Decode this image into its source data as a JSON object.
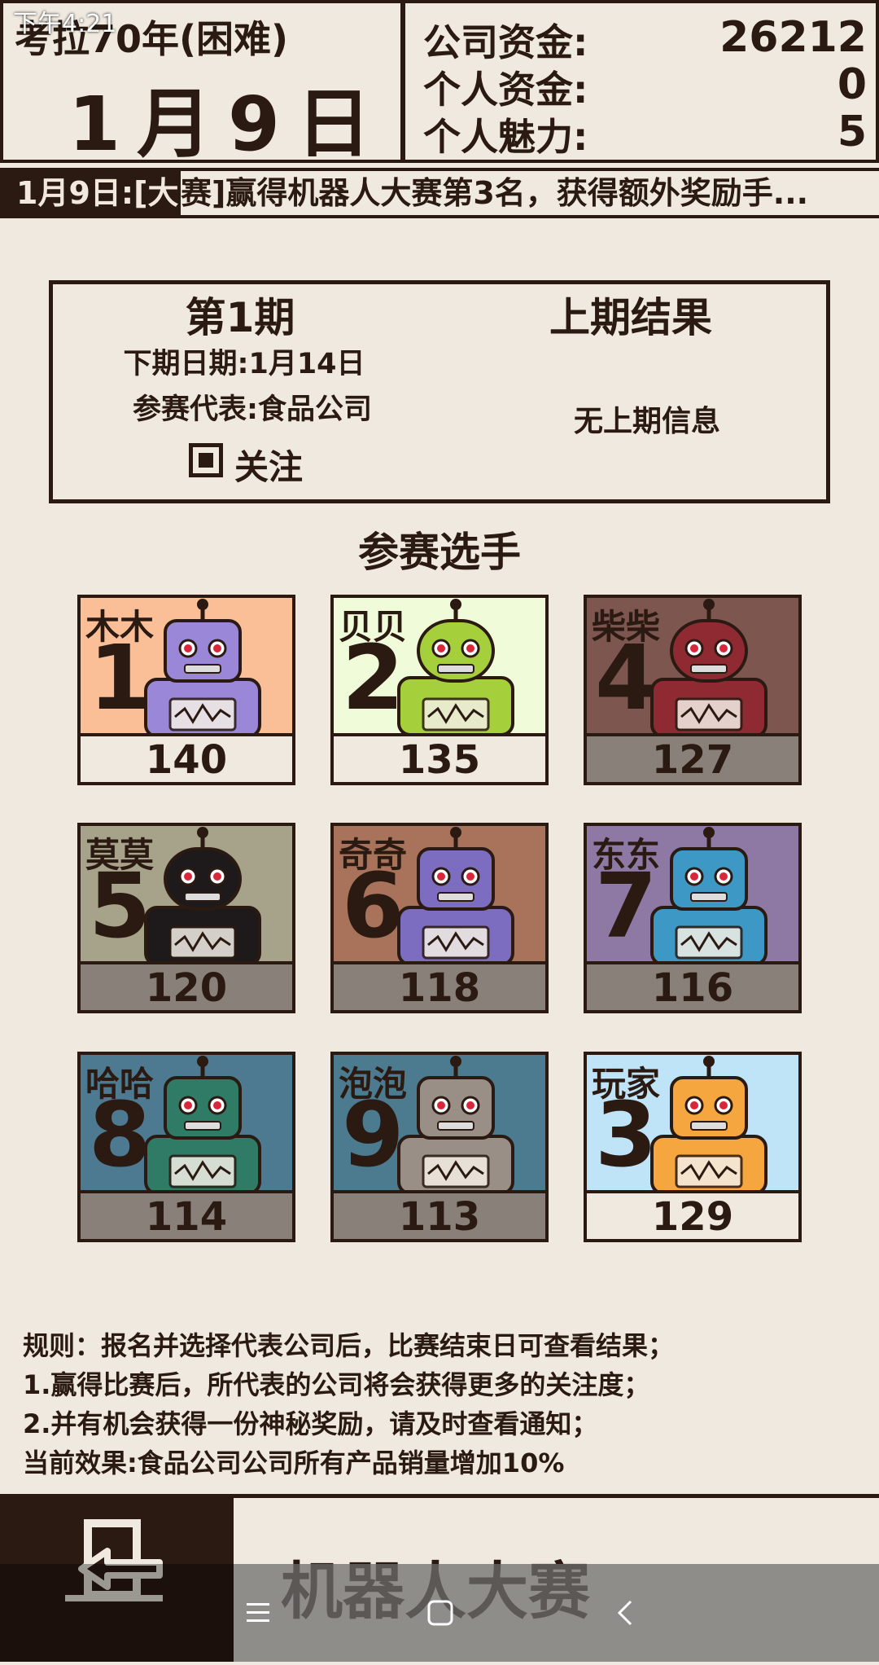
{
  "status": {
    "time": "下午4:21"
  },
  "header": {
    "era": "考拉70年(困难)",
    "date": "1月9日",
    "company_funds_label": "公司资金:",
    "company_funds": "26212",
    "personal_funds_label": "个人资金:",
    "personal_funds": "0",
    "charm_label": "个人魅力:",
    "charm": "5"
  },
  "ticker": {
    "date": "1月9日:[大",
    "text": "赛]赢得机器人大赛第3名，获得额外奖励手..."
  },
  "panel": {
    "period": "第1期",
    "next_date": "下期日期:1月14日",
    "representative": "参赛代表:食品公司",
    "follow_label": "关注",
    "follow_checked": true,
    "last_result_title": "上期结果",
    "last_result_info": "无上期信息"
  },
  "section_title": "参赛选手",
  "contestants": [
    {
      "name": "木木",
      "number": "1",
      "score": "140",
      "bg": "#fbbf97",
      "score_bg": "#efe9df",
      "body": "#9b87d8"
    },
    {
      "name": "贝贝",
      "number": "2",
      "score": "135",
      "bg": "#f0fbd9",
      "score_bg": "#efe9df",
      "body": "#a6cf3c"
    },
    {
      "name": "柴柴",
      "number": "4",
      "score": "127",
      "bg": "#7d5650",
      "score_bg": "#898079",
      "body": "#8f2a33"
    },
    {
      "name": "莫莫",
      "number": "5",
      "score": "120",
      "bg": "#a6a38a",
      "score_bg": "#898079",
      "body": "#1e1a1c"
    },
    {
      "name": "奇奇",
      "number": "6",
      "score": "118",
      "bg": "#a8735a",
      "score_bg": "#898079",
      "body": "#7d6dc0"
    },
    {
      "name": "东东",
      "number": "7",
      "score": "116",
      "bg": "#8d79a4",
      "score_bg": "#898079",
      "body": "#3d98c6"
    },
    {
      "name": "哈哈",
      "number": "8",
      "score": "114",
      "bg": "#4d7a90",
      "score_bg": "#898079",
      "body": "#2f7b66"
    },
    {
      "name": "泡泡",
      "number": "9",
      "score": "113",
      "bg": "#4c7a8f",
      "score_bg": "#898079",
      "body": "#9a8f86"
    },
    {
      "name": "玩家",
      "number": "3",
      "score": "129",
      "bg": "#bfe3f7",
      "score_bg": "#efe9df",
      "body": "#f5a63e"
    }
  ],
  "rules": [
    "规则：报名并选择代表公司后，比赛结束日可查看结果；",
    "1.赢得比赛后，所代表的公司将会获得更多的关注度；",
    "2.并有机会获得一份神秘奖励，请及时查看通知；",
    "当前效果:食品公司公司所有产品销量增加10%"
  ],
  "page_title": "机器人大赛",
  "icons": {
    "exit": "exit-door-icon",
    "nav_menu": "menu-icon",
    "nav_home": "home-icon",
    "nav_back": "back-icon"
  }
}
